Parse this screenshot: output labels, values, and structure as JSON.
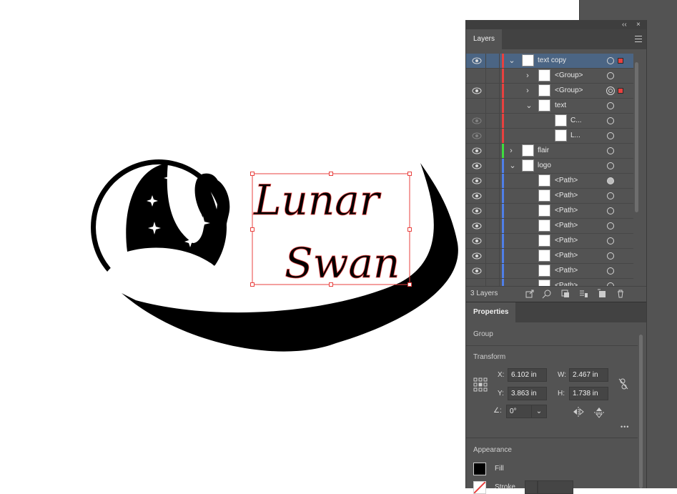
{
  "artwork": {
    "title_line1": "Lunar",
    "title_line2": "Swan"
  },
  "layers_panel": {
    "tab_label": "Layers",
    "collapse_label": "‹‹",
    "close_label": "×",
    "rows": [
      {
        "name": "text copy",
        "color": "#e8413f",
        "selected": true
      },
      {
        "name": "<Group>",
        "color": "#e8413f"
      },
      {
        "name": "<Group>",
        "color": "#e8413f"
      },
      {
        "name": "text",
        "color": "#e8413f"
      },
      {
        "name": "C...",
        "color": "#e8413f"
      },
      {
        "name": "L...",
        "color": "#e8413f"
      },
      {
        "name": "flair",
        "color": "#3fdc3f"
      },
      {
        "name": "logo",
        "color": "#4f7fe8"
      },
      {
        "name": "<Path>",
        "color": "#4f7fe8"
      },
      {
        "name": "<Path>",
        "color": "#4f7fe8"
      },
      {
        "name": "<Path>",
        "color": "#4f7fe8"
      },
      {
        "name": "<Path>",
        "color": "#4f7fe8"
      },
      {
        "name": "<Path>",
        "color": "#4f7fe8"
      },
      {
        "name": "<Path>",
        "color": "#4f7fe8"
      },
      {
        "name": "<Path>",
        "color": "#4f7fe8"
      },
      {
        "name": "<Path>",
        "color": "#4f7fe8"
      }
    ],
    "count_label": "3 Layers"
  },
  "properties_panel": {
    "tab_label": "Properties",
    "object_type": "Group",
    "transform_label": "Transform",
    "x_label": "X:",
    "x_value": "6.102 in",
    "y_label": "Y:",
    "y_value": "3.863 in",
    "w_label": "W:",
    "w_value": "2.467 in",
    "h_label": "H:",
    "h_value": "1.738 in",
    "angle_label": "∠:",
    "angle_value": "0°",
    "more_label": "•••",
    "appearance_label": "Appearance",
    "fill_label": "Fill",
    "stroke_label": "Stroke"
  },
  "colors": {
    "selection_red": "#e8413f",
    "layer_green": "#3fdc3f",
    "layer_blue": "#4f7fe8",
    "panel_bg": "#535353",
    "selected_row": "#4b6584"
  }
}
